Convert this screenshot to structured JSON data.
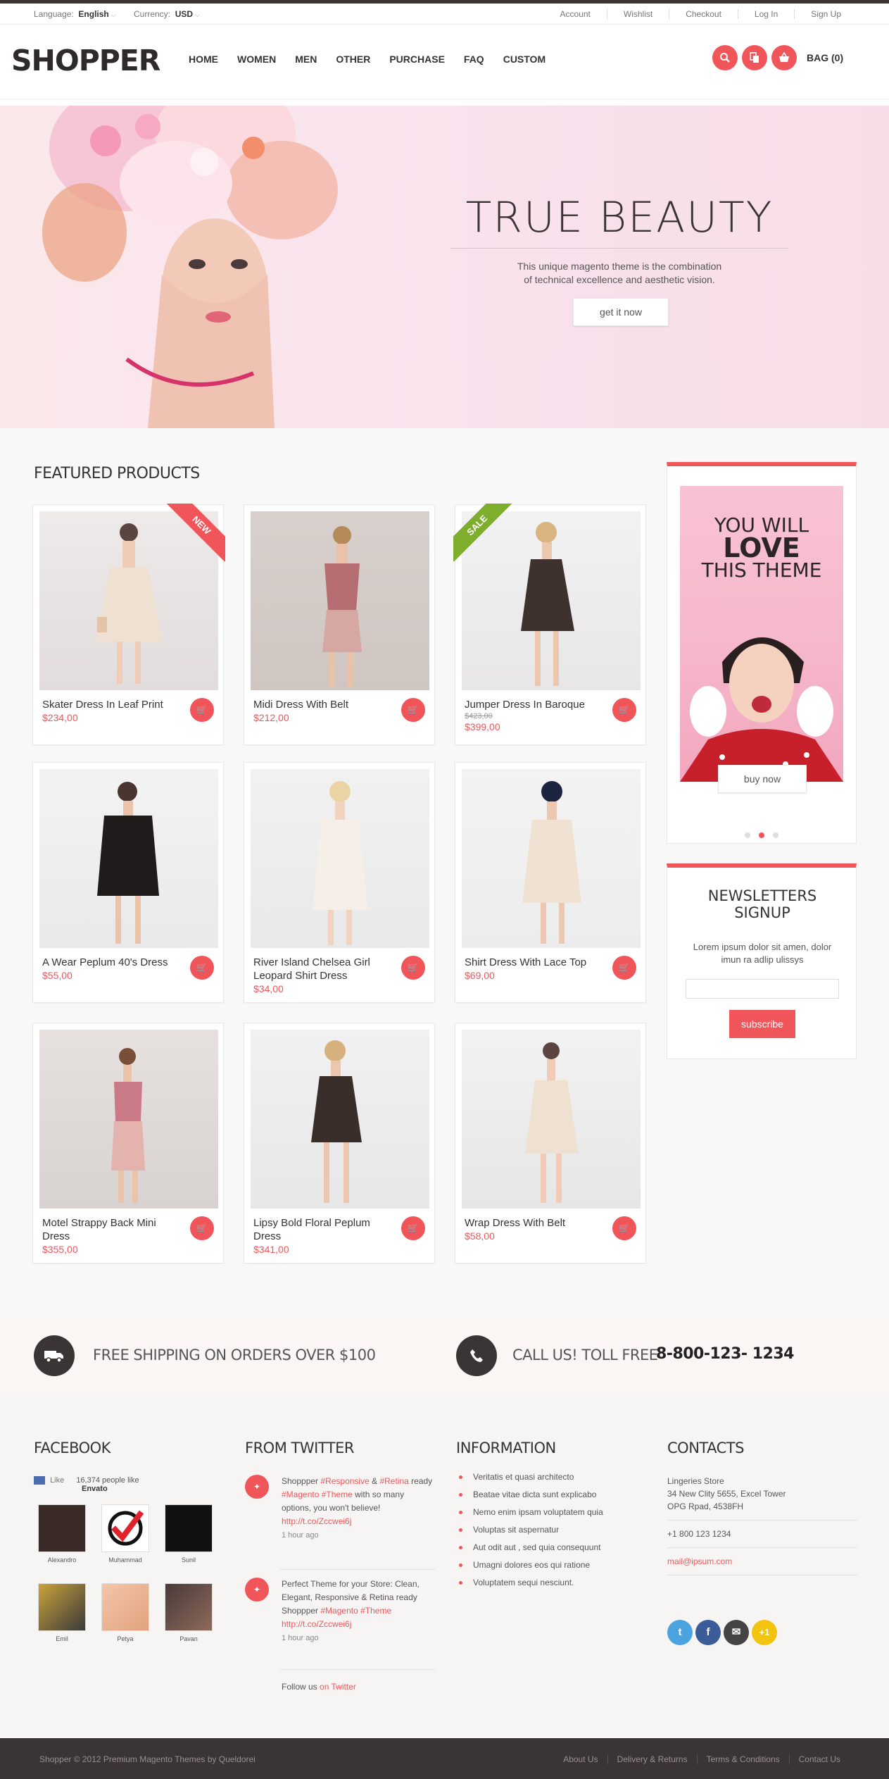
{
  "topbar": {
    "language_label": "Language:",
    "language_value": "English",
    "currency_label": "Currency:",
    "currency_value": "USD",
    "links": [
      "Account",
      "Wishlist",
      "Checkout",
      "Log In",
      "Sign Up"
    ]
  },
  "header": {
    "logo": "SHOPPER",
    "nav": [
      "HOME",
      "WOMEN",
      "MEN",
      "OTHER",
      "PURCHASE",
      "FAQ",
      "CUSTOM"
    ],
    "bag_label": "BAG (0)",
    "icons": [
      "search-icon",
      "compare-icon",
      "cart-icon"
    ]
  },
  "hero": {
    "title": "TRUE BEAUTY",
    "subtitle_1": "This unique magento theme is the combination",
    "subtitle_2": "of technical excellence and aesthetic vision.",
    "button": "get it now"
  },
  "featured": {
    "title": "FEATURED PRODUCTS",
    "products": [
      {
        "name": "Skater Dress In Leaf Print",
        "price": "$234,00",
        "badge": "NEW"
      },
      {
        "name": "Midi Dress With Belt",
        "price": "$212,00"
      },
      {
        "name": "Jumper Dress In Baroque",
        "old_price": "$423,00",
        "price": "$399,00",
        "badge": "SALE"
      },
      {
        "name": "A Wear Peplum 40's Dress",
        "price": "$55,00"
      },
      {
        "name": "River Island Chelsea Girl Leopard Shirt Dress",
        "price": "$34,00"
      },
      {
        "name": "Shirt Dress With Lace Top",
        "price": "$69,00"
      },
      {
        "name": "Motel Strappy Back Mini Dress",
        "price": "$355,00"
      },
      {
        "name": "Lipsy Bold Floral Peplum Dress",
        "price": "$341,00"
      },
      {
        "name": "Wrap Dress With Belt",
        "price": "$58,00"
      }
    ]
  },
  "promo": {
    "line1": "YOU WILL",
    "line2": "LOVE",
    "line3": "THIS THEME",
    "button": "buy now"
  },
  "newsletter": {
    "title_1": "NEWSLETTERS",
    "title_2": "SIGNUP",
    "text": "Lorem ipsum dolor sit amen, dolor imun ra adlip ulissys",
    "input_value": "",
    "button": "subscribe"
  },
  "shipping": {
    "text": "FREE SHIPPING ON ORDERS OVER $100",
    "call_text": "CALL US!  TOLL FREE",
    "phone": "8-800-123- 1234"
  },
  "footer": {
    "facebook": {
      "title": "FACEBOOK",
      "like": "Like",
      "count": "16,374 people like",
      "page": "Envato",
      "people": [
        "Alexandro",
        "Muhammad",
        "Sunil",
        "Emil",
        "Petya",
        "Pavan"
      ]
    },
    "twitter": {
      "title": "FROM TWITTER",
      "tweet1_a": "Shoppper ",
      "tweet1_b": "#Responsive",
      "tweet1_c": " & ",
      "tweet1_d": "#Retina",
      "tweet1_e": " ready ",
      "tweet1_f": "#Magento",
      "tweet1_g": " ",
      "tweet1_h": "#Theme",
      "tweet1_i": " with so many options, you won't believe!",
      "tweet1_link": "http://t.co/Zccwei6j",
      "tweet1_time": "1 hour ago",
      "tweet2_a": "Perfect Theme for your Store: Clean, Elegant, Responsive & Retina ready Shoppper ",
      "tweet2_b": "#Magento",
      "tweet2_c": " ",
      "tweet2_d": "#Theme",
      "tweet2_link": "http://t.co/Zccwei6j",
      "tweet2_time": "1 hour ago",
      "follow": "Follow us ",
      "follow_link": "on Twitter"
    },
    "information": {
      "title": "INFORMATION",
      "items": [
        "Veritatis et quasi architecto",
        "Beatae vitae dicta sunt explicabo",
        "Nemo enim ipsam voluptatem quia",
        "Voluptas sit aspernatur",
        "Aut odit aut , sed quia consequunt",
        "Umagni dolores eos qui ratione",
        "Voluptatem sequi nesciunt."
      ]
    },
    "contacts": {
      "title": "CONTACTS",
      "store": "Lingeries Store",
      "address1": "34 New Clity 5655, Excel Tower",
      "address2": "OPG Rpad, 4538FH",
      "phone": "+1 800 123 1234",
      "email": "mail@ipsum.com",
      "social": [
        "twitter-icon",
        "facebook-icon",
        "mail-icon",
        "+1"
      ]
    }
  },
  "bottom": {
    "copyright": "Shopper © 2012 Premium Magento Themes by Queldorei",
    "links": [
      "About Us",
      "Delivery & Returns",
      "Terms & Conditions",
      "Contact Us"
    ]
  },
  "colors": {
    "accent": "#f0555a",
    "dark": "#3b3434",
    "sale": "#7fad2c"
  }
}
